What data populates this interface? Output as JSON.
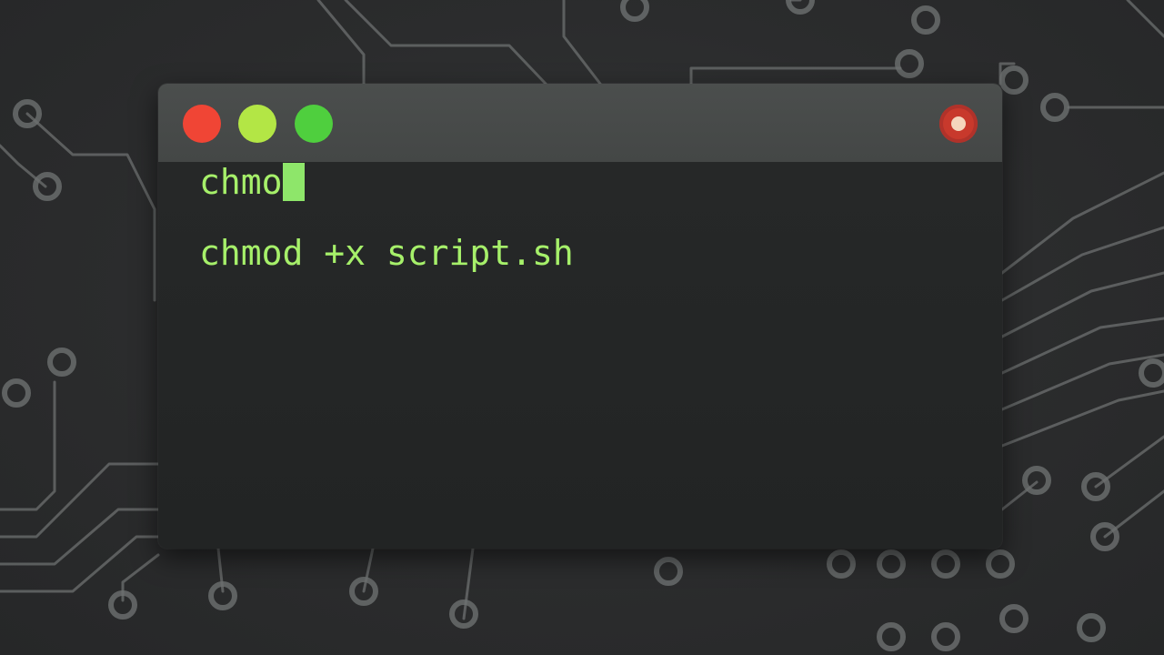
{
  "theme": {
    "background": "#2c2d2e",
    "circuit_color": "#6d7070",
    "terminal_text_color": "#a6f06a",
    "cursor_color": "#8ee66a",
    "close_color": "#f04535",
    "minimize_color": "#b3e645",
    "zoom_color": "#4fcf3e",
    "record_color": "#c8392c"
  },
  "window": {
    "controls": [
      {
        "name": "close",
        "icon": "close-dot-icon"
      },
      {
        "name": "minimize",
        "icon": "minimize-dot-icon"
      },
      {
        "name": "zoom",
        "icon": "zoom-dot-icon"
      }
    ],
    "record_icon": "record-icon"
  },
  "terminal": {
    "lines": [
      {
        "text": "chmo",
        "has_cursor": true
      },
      {
        "text": "chmod +x script.sh",
        "has_cursor": false
      }
    ]
  }
}
